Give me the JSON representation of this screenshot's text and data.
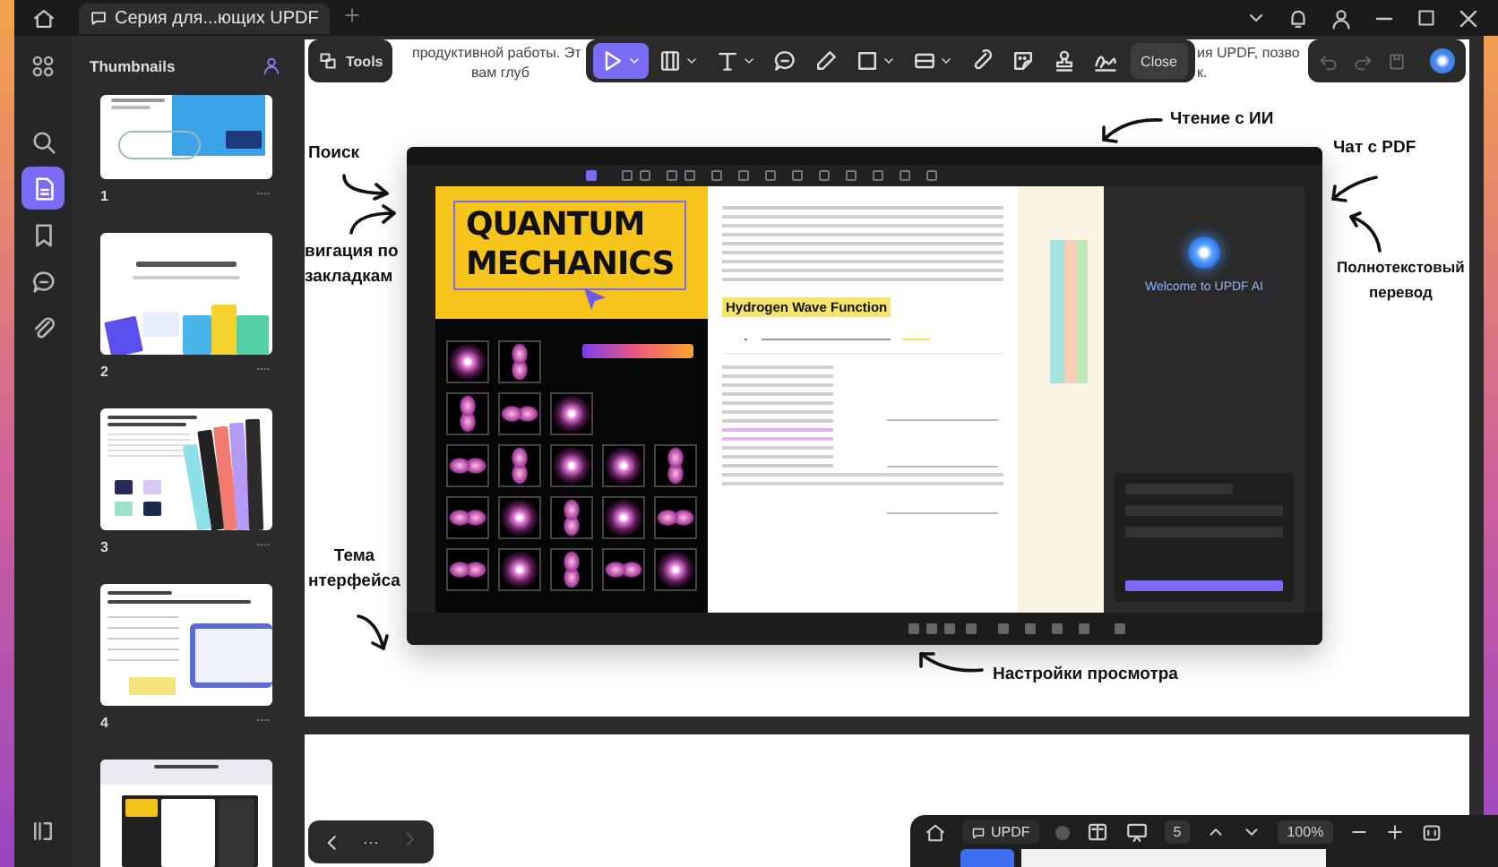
{
  "title_bar": {
    "tabs": [
      {
        "label": "Серия для...ющих UPDF",
        "selected": true
      }
    ]
  },
  "rail": {
    "items": [
      {
        "kind": "search",
        "selected": false
      },
      {
        "kind": "pages",
        "selected": true
      },
      {
        "kind": "bookmark",
        "selected": false
      },
      {
        "kind": "comment",
        "selected": false
      },
      {
        "kind": "attachment",
        "selected": false
      }
    ]
  },
  "thumbnails": {
    "title": "Thumbnails",
    "pages": [
      {
        "number": "1",
        "selected": false
      },
      {
        "number": "2",
        "selected": false
      },
      {
        "number": "3",
        "selected": false
      },
      {
        "number": "4",
        "selected": false
      },
      {
        "selected": false
      }
    ]
  },
  "toolbar": {
    "tools_button": "Tools",
    "tools": [
      {
        "kind": "select",
        "selected": true
      },
      {
        "kind": "frame",
        "selected": false
      },
      {
        "kind": "text",
        "selected": false
      },
      {
        "kind": "comment",
        "selected": false
      },
      {
        "kind": "pen",
        "selected": false
      },
      {
        "kind": "shape",
        "selected": false
      },
      {
        "kind": "strikeout",
        "selected": false
      },
      {
        "kind": "clip",
        "selected": false
      },
      {
        "kind": "emoji",
        "selected": false
      },
      {
        "kind": "stamp",
        "selected": false
      },
      {
        "kind": "signature",
        "selected": false
      }
    ],
    "close_button": "Close"
  },
  "page": {
    "text_fragments": [
      "продуктивной работы. Эт",
      "ия UPDF, позво",
      "вам глуб",
      "к."
    ],
    "annotations": [
      {
        "lines": [
          "Поиск"
        ]
      },
      {
        "lines": [
          "вигация по",
          "закладкам"
        ]
      },
      {
        "lines": [
          "Тема",
          "нтерфейса"
        ]
      },
      {
        "lines": [
          "Чтение с ИИ"
        ]
      },
      {
        "lines": [
          "Чат с PDF"
        ]
      },
      {
        "lines": [
          "Полнотекстовый",
          "перевод"
        ]
      },
      {
        "lines": [
          "Настройки просмотра"
        ]
      }
    ],
    "screenshot": {
      "title_lines": [
        "QUANTUM",
        "MECHANICS"
      ],
      "highlight": "Hydrogen Wave Function",
      "ai_welcome": "Welcome to UPDF AI"
    }
  },
  "page_nav": {
    "more": "···"
  },
  "bottom_window": {
    "tab": "UPDF",
    "page_current": "5",
    "zoom": "100%"
  }
}
